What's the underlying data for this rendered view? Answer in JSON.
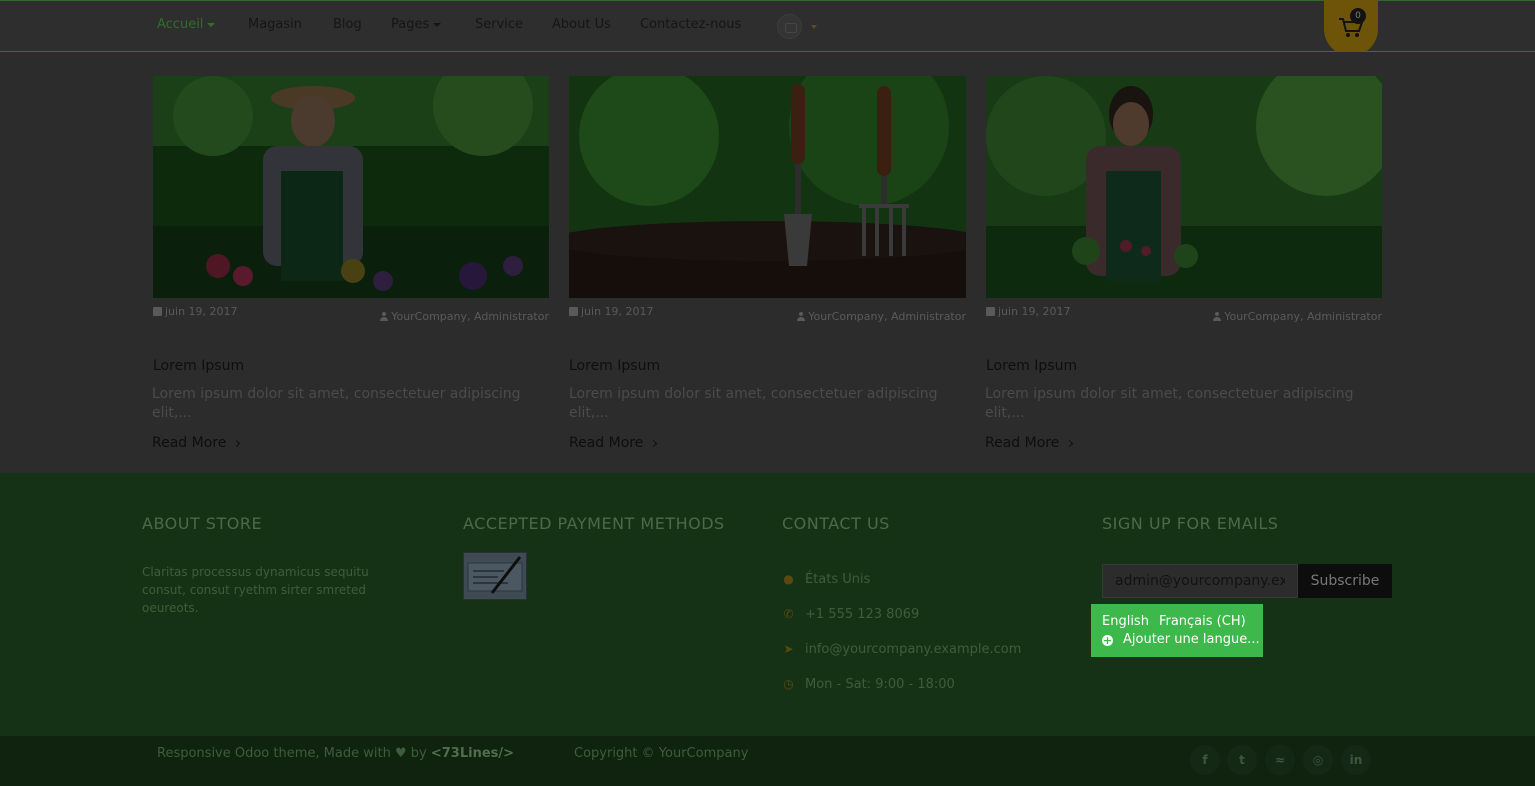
{
  "nav": {
    "items": [
      {
        "label": "Accueil",
        "dropdown": true,
        "active": true
      },
      {
        "label": "Magasin",
        "dropdown": false
      },
      {
        "label": "Blog",
        "dropdown": false
      },
      {
        "label": "Pages",
        "dropdown": true
      },
      {
        "label": "Service",
        "dropdown": false
      },
      {
        "label": "About Us",
        "dropdown": false
      },
      {
        "label": "Contactez-nous",
        "dropdown": false
      }
    ],
    "cart_count": "0"
  },
  "posts": [
    {
      "date": "juin 19, 2017",
      "author": "YourCompany, Administrator",
      "title": "Lorem Ipsum",
      "excerpt": "Lorem ipsum dolor sit amet, consectetuer adipiscing elit,...",
      "read_more": "Read More",
      "image": "gardener-man"
    },
    {
      "date": "juin 19, 2017",
      "author": "YourCompany, Administrator",
      "title": "Lorem Ipsum",
      "excerpt": "Lorem ipsum dolor sit amet, consectetuer adipiscing elit,...",
      "read_more": "Read More",
      "image": "garden-tools"
    },
    {
      "date": "juin 19, 2017",
      "author": "YourCompany, Administrator",
      "title": "Lorem Ipsum",
      "excerpt": "Lorem ipsum dolor sit amet, consectetuer adipiscing elit,...",
      "read_more": "Read More",
      "image": "gardener-woman"
    }
  ],
  "footer": {
    "about": {
      "heading": "ABOUT STORE",
      "text": "Claritas processus dynamicus sequitu consut, consut ryethm sirter smreted oeureots."
    },
    "payment": {
      "heading": "ACCEPTED PAYMENT METHODS",
      "icon": "cheque-icon"
    },
    "contact": {
      "heading": "CONTACT US",
      "rows": [
        {
          "icon": "map-marker-icon",
          "text": "États Unis"
        },
        {
          "icon": "phone-icon",
          "text": "+1 555 123 8069"
        },
        {
          "icon": "paper-plane-icon",
          "text": "info@yourcompany.example.com"
        },
        {
          "icon": "clock-icon",
          "text": "Mon - Sat: 9:00 - 18:00"
        }
      ]
    },
    "signup": {
      "heading": "SIGN UP FOR EMAILS",
      "email_value": "admin@yourcompany.example.com",
      "subscribe_label": "Subscribe"
    },
    "languages": {
      "current": "English",
      "other": "Français (CH)",
      "add_label": "Ajouter une langue..."
    }
  },
  "bottom": {
    "made_with_prefix": "Responsive Odoo theme, Made with",
    "made_with_by": "by",
    "made_with_brand": "<73Lines/>",
    "copyright": "Copyright © YourCompany",
    "social": [
      "facebook-icon",
      "twitter-icon",
      "rss-icon",
      "instagram-icon",
      "linkedin-icon"
    ]
  },
  "colors": {
    "accent": "#3db84a",
    "cart": "#6d5408",
    "footer": "#163216"
  }
}
